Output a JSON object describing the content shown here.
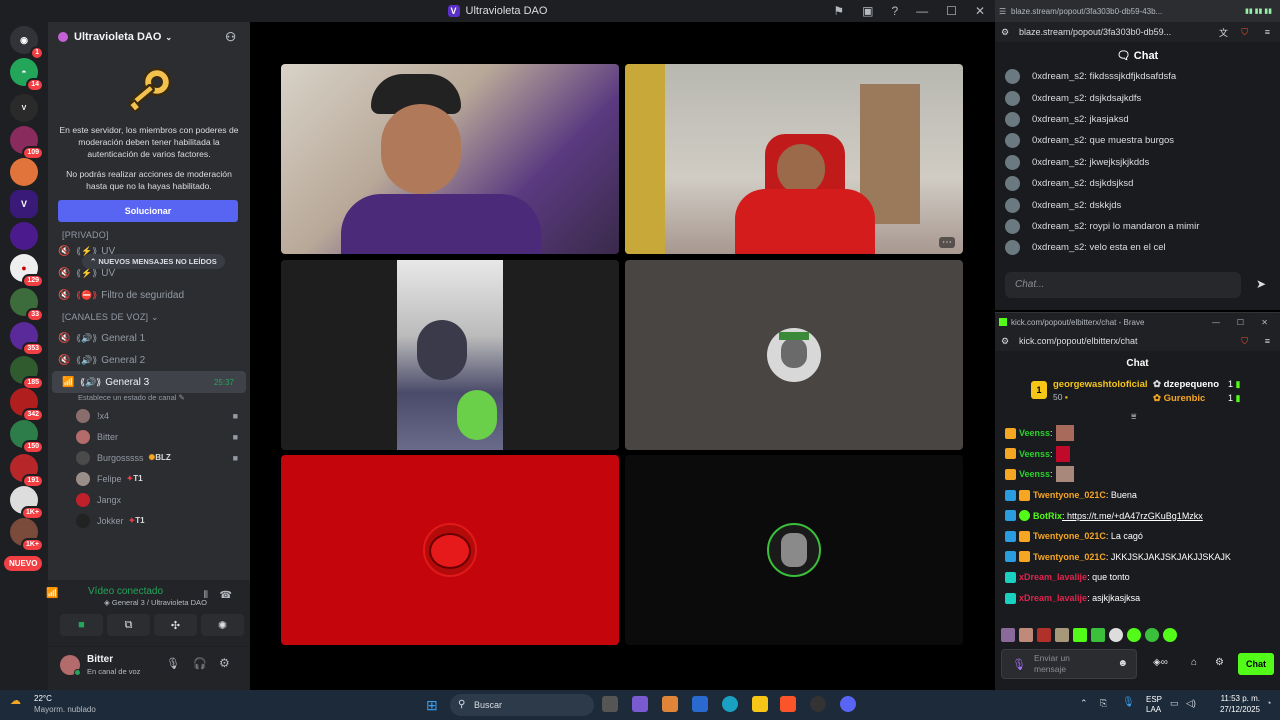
{
  "titlebar": {
    "title": "Ultravioleta DAO",
    "logo_letter": "V"
  },
  "rail": {
    "badges": [
      "1",
      "14",
      "109",
      "129",
      "33",
      "353",
      "185",
      "342",
      "150",
      "191",
      "1K+",
      "1K+"
    ],
    "nuevo": "NUEVO"
  },
  "sidebar": {
    "server_name": "Ultravioleta DAO",
    "mfa_text_1": "En este servidor, los miembros con poderes de moderación deben tener habilitada la autenticación de varios factores.",
    "mfa_text_2": "No podrás realizar acciones de moderación hasta que no la hayas habilitado.",
    "fix_button": "Solucionar",
    "unread_pill": "NUEVOS MENSAJES NO LEÍDOS",
    "cat_privado": "[PRIVADO]",
    "channels_top": [
      {
        "label": "UV"
      },
      {
        "label": "UV"
      },
      {
        "label": "Filtro de seguridad"
      }
    ],
    "cat_voice": "[CANALES DE VOZ]",
    "voice_channels": [
      {
        "label": "General 1"
      },
      {
        "label": "General 2"
      },
      {
        "label": "General 3",
        "time": "25:37",
        "status": "Establece un estado de canal"
      }
    ],
    "members": [
      {
        "name": "!x4",
        "tag": "",
        "color": "#8a6d6d"
      },
      {
        "name": "Bitter",
        "tag": "",
        "color": "#b46b6b"
      },
      {
        "name": "Burgosssss",
        "tag": "BLZ",
        "color": "#4a4a4a"
      },
      {
        "name": "Felipe",
        "tag": "T1",
        "color": "#9a8f88"
      },
      {
        "name": "Jangx",
        "tag": "",
        "color": "#c0202a"
      },
      {
        "name": "Jokker",
        "tag": "T1",
        "color": "#222"
      }
    ]
  },
  "voice_panel": {
    "status": "Vídeo conectado",
    "location": "General 3 / Ultravioleta DAO"
  },
  "user_panel": {
    "name": "Bitter",
    "status": "En canal de voz"
  },
  "blaze": {
    "window_title": "blaze.stream/popout/3fa303b0-db59-43b...",
    "url": "blaze.stream/popout/3fa303b0-db59...",
    "chat_title": "Chat",
    "messages": [
      "0xdream_s2: fikdsssjkdfjkdsafdsfa",
      "0xdream_s2: dsjkdsajkdfs",
      "0xdream_s2: jkasjaksd",
      "0xdream_s2: que muestra burgos",
      "0xdream_s2: jkwejksjkjkdds",
      "0xdream_s2: dsjkdsjksd",
      "0xdream_s2: dskkjds",
      "0xdream_s2: roypi lo mandaron a mimir",
      "0xdream_s2: velo esta en el cel"
    ],
    "input_placeholder": "Chat..."
  },
  "kick": {
    "window_title": "kick.com/popout/elbitterx/chat - Brave",
    "url": "kick.com/popout/elbitterx/chat",
    "chat_title": "Chat",
    "leader": {
      "name": "georgewashtoloficial",
      "points": "50"
    },
    "top": [
      {
        "name": "dzepequeno",
        "count": "1"
      },
      {
        "name": "Gurenbic",
        "count": "1"
      }
    ],
    "messages": [
      {
        "user": "Veenss",
        "text": "",
        "color": "#2bd02b"
      },
      {
        "user": "Veenss",
        "text": "",
        "color": "#2bd02b"
      },
      {
        "user": "Veenss",
        "text": "",
        "color": "#2bd02b"
      },
      {
        "user": "Twentyone_021C",
        "text": ": Buena",
        "color": "#f5a623"
      },
      {
        "user": "BotRix",
        "text": ": https://t.me/+dA47rzGKuBg1Mzkx",
        "color": "#53fc18"
      },
      {
        "user": "Twentyone_021C",
        "text": ": La cagó",
        "color": "#f5a623"
      },
      {
        "user": "Twentyone_021C",
        "text": ": JKKJSKJAKJSKJAKJJSKAJK",
        "color": "#f5a623"
      },
      {
        "user": "xDream_lavalije",
        "text": ": que tonto",
        "color": "#e0234e"
      },
      {
        "user": "xDream_lavalije",
        "text": ": asjkjkasjksa",
        "color": "#e0234e"
      }
    ],
    "input_placeholder": "Enviar un mensaje",
    "send_button": "Chat"
  },
  "taskbar": {
    "weather_temp": "22°C",
    "weather_desc": "Mayorm. nublado",
    "search": "Buscar",
    "lang": "ESP",
    "lang2": "LAA",
    "time": "11:53 p. m.",
    "date": "27/12/2025"
  }
}
